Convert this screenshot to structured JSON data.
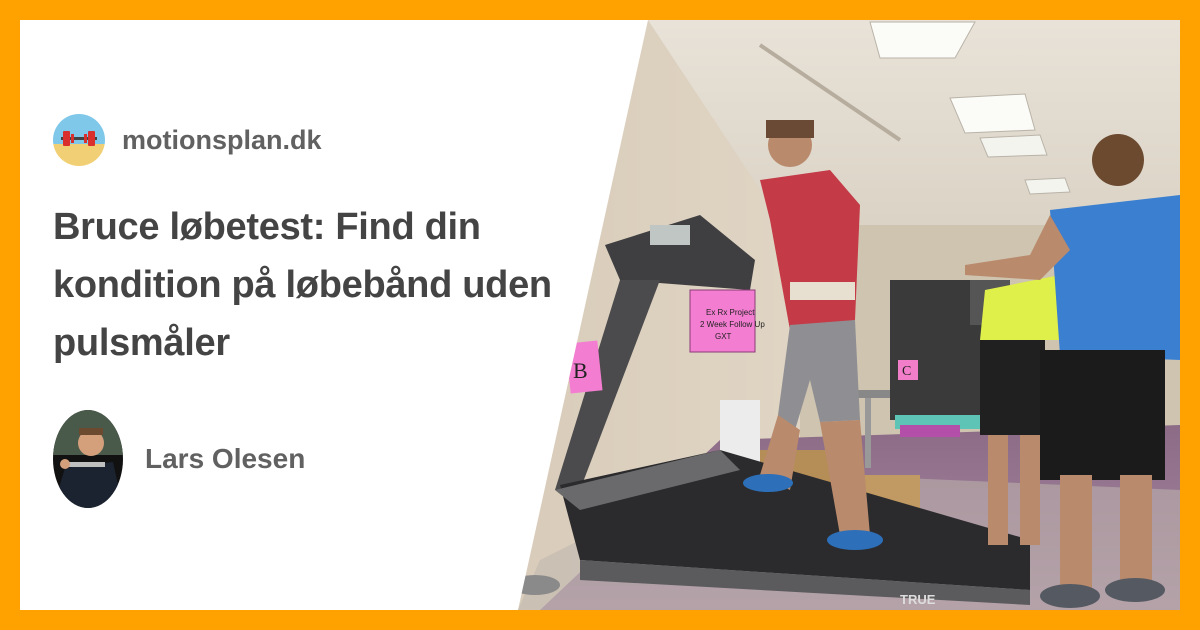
{
  "brand": {
    "frame_color": "#FFA200",
    "text_color": "#444444",
    "muted_text_color": "#616161"
  },
  "site": {
    "name": "motionsplan.dk",
    "logo_icon": "barbell-beach-logo"
  },
  "article": {
    "title": "Bruce løbetest: Find din kondition på løbebånd uden pulsmåler"
  },
  "author": {
    "name": "Lars Olesen",
    "avatar_icon": "author-portrait"
  },
  "photo": {
    "description_icon": "treadmill-test-photo",
    "sign_labels": [
      "B",
      "C"
    ],
    "sign_note": "Ex Rx Project 2 Week Follow Up GXT",
    "brand_label": "TRUE"
  }
}
